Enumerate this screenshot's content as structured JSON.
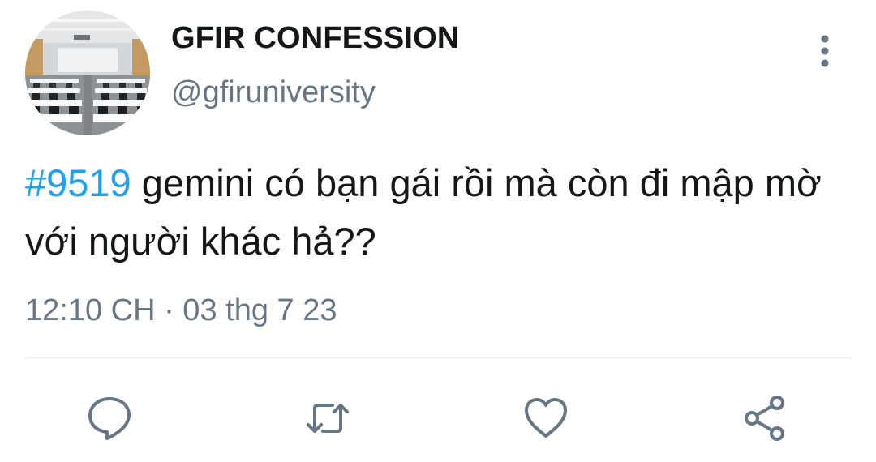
{
  "account": {
    "display_name": "GFIR CONFESSION",
    "handle": "@gfiruniversity",
    "avatar": "classroom-photo"
  },
  "tweet": {
    "hashtag": "#9519",
    "text": " gemini có bạn gái rồi mà còn đi mập mờ với người khác hả??",
    "timestamp": "12:10 CH · 03 thg 7 23"
  },
  "actions": [
    {
      "name": "reply",
      "icon": "comment-bubble-icon"
    },
    {
      "name": "retweet",
      "icon": "retweet-icon"
    },
    {
      "name": "like",
      "icon": "heart-icon"
    },
    {
      "name": "share",
      "icon": "share-icon"
    }
  ],
  "colors": {
    "hashtag": "#1da1f2",
    "secondary_text": "#657786",
    "primary_text": "#14171a",
    "divider": "#e6ecf0"
  }
}
